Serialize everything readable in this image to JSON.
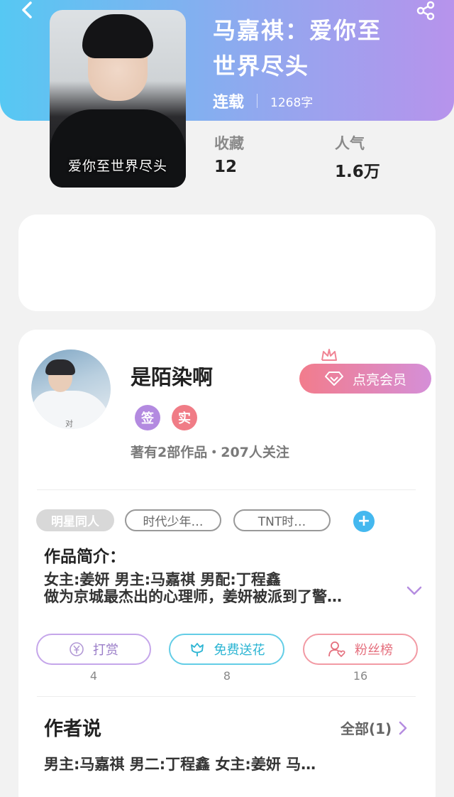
{
  "header": {
    "book_title_line1": "马嘉祺：爱你至",
    "book_title_line2": "世界尽头",
    "status": "连载",
    "word_count": "1268字",
    "cover_title": "爱你至世界尽头"
  },
  "stats": {
    "favorites_label": "收藏",
    "favorites_value": "12",
    "popularity_label": "人气",
    "popularity_value": "1.6万"
  },
  "author": {
    "name": "是陌染啊",
    "avatar_caption": "对",
    "badge_signed": "签",
    "badge_real": "实",
    "meta": "著有2部作品・207人关注",
    "vip_label": "点亮会员"
  },
  "tags": {
    "items": [
      "明星同人",
      "时代少年…",
      "TNT时…"
    ],
    "add_label": "+"
  },
  "intro": {
    "title": "作品简介：",
    "line1": "女主:姜妍 男主:马嘉祺 男配:丁程鑫",
    "line2": "做为京城最杰出的心理师，姜妍被派到了警…"
  },
  "actions": {
    "reward_label": "打赏",
    "reward_count": "4",
    "flower_label": "免费送花",
    "flower_count": "8",
    "fans_label": "粉丝榜",
    "fans_count": "16"
  },
  "author_says": {
    "title": "作者说",
    "see_all": "全部(1)",
    "text": "男主:马嘉祺 男二:丁程鑫 女主:姜妍 马…"
  },
  "colors": {
    "header_gradient_start": "#56c8f3",
    "header_gradient_end": "#b793ec",
    "vip_gradient_start": "#f27c8c",
    "vip_gradient_end": "#d58fd8",
    "accent_blue": "#44b8ef"
  }
}
